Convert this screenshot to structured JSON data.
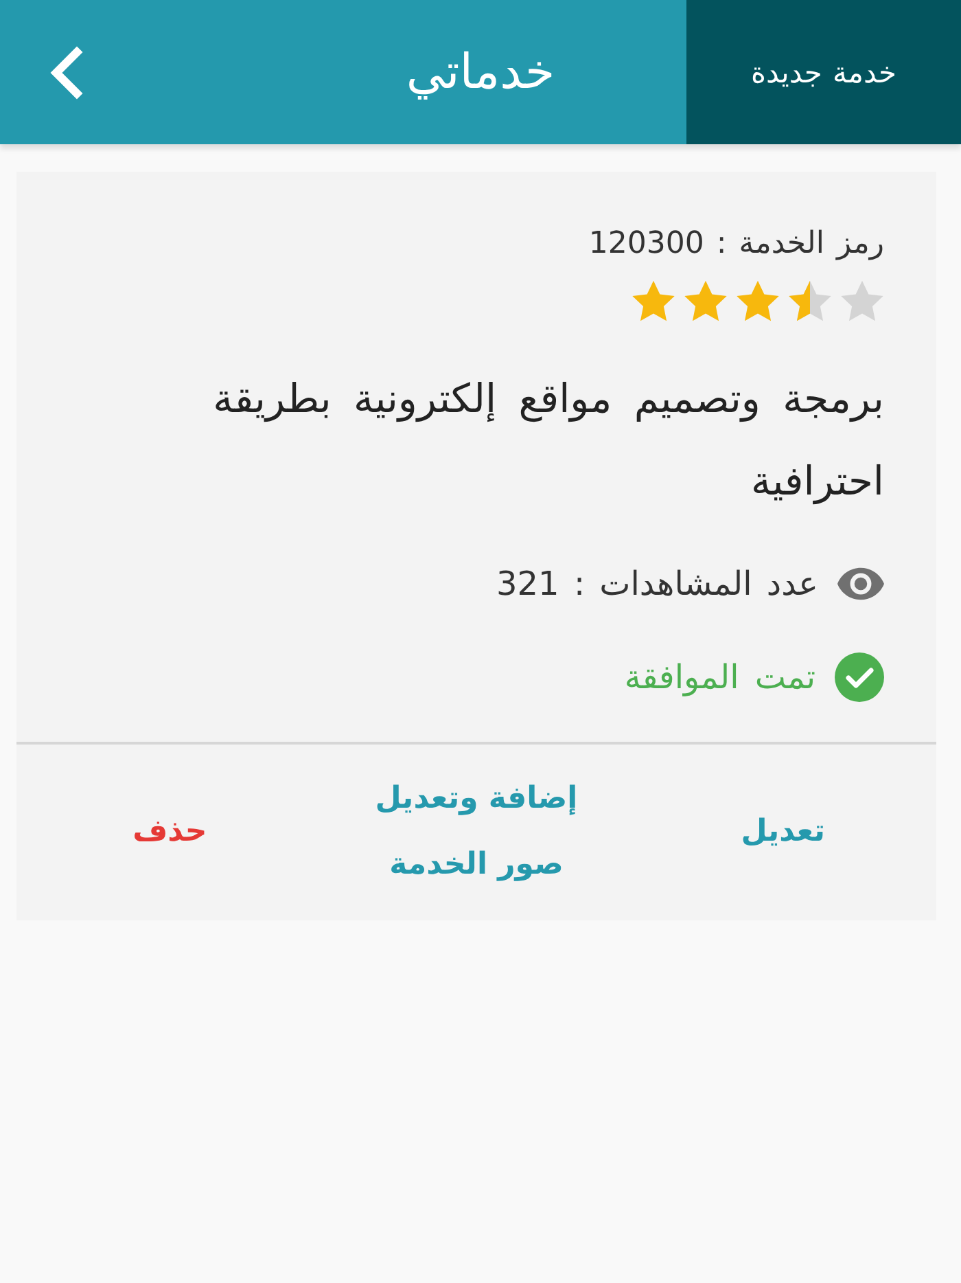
{
  "header": {
    "title": "خدماتي",
    "new_service_button": "خدمة جديدة"
  },
  "service": {
    "code_label": "رمز الخدمة : 120300",
    "stars": 3.5,
    "title": "برمجة وتصميم مواقع إلكترونية بطريقة احترافية",
    "views": "عدد المشاهدات : 321",
    "status": {
      "text": "تمت الموافقة",
      "approved": true
    }
  },
  "actions": [
    {
      "label": "تعديل",
      "kind": "primary"
    },
    {
      "label": "إضافة وتعديل صور الخدمة",
      "kind": "primary"
    },
    {
      "label": "حذف",
      "kind": "danger"
    }
  ]
}
